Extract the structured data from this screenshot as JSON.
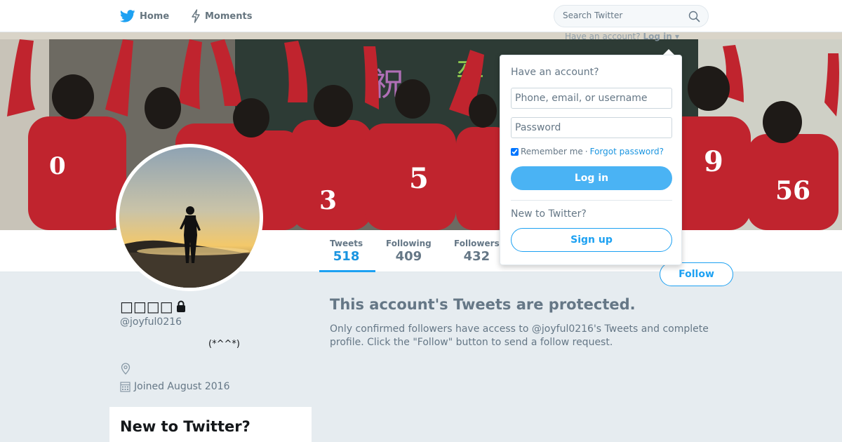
{
  "nav": {
    "home_label": "Home",
    "moments_label": "Moments",
    "search_placeholder": "Search Twitter",
    "login_hint_prefix": "Have an account?",
    "login_hint_link": "Log in ▾"
  },
  "profile_nav": {
    "stats": [
      {
        "label": "Tweets",
        "value": "518"
      },
      {
        "label": "Following",
        "value": "409"
      },
      {
        "label": "Followers",
        "value": "432"
      }
    ],
    "follow_label": "Follow"
  },
  "profile": {
    "name": "□□□□",
    "screen_name": "@joyful0216",
    "bio": "(*^^*)",
    "joined": "Joined August 2016"
  },
  "protected": {
    "title": "This account's Tweets are protected.",
    "text": "Only confirmed followers have access to @joyful0216's Tweets and complete profile. Click the \"Follow\" button to send a follow request."
  },
  "new_card": {
    "title": "New to Twitter?"
  },
  "login_dropdown": {
    "heading": "Have an account?",
    "username_placeholder": "Phone, email, or username",
    "password_placeholder": "Password",
    "remember_label": "Remember me",
    "separator": "·",
    "forgot_label": "Forgot password?",
    "login_label": "Log in",
    "new_heading": "New to Twitter?",
    "signup_label": "Sign up"
  },
  "banner_jerseys": [
    "0",
    "3",
    "5",
    "9",
    "56"
  ],
  "icons": {
    "home": "bird-icon",
    "moments": "lightning-icon",
    "search": "search-icon",
    "location": "location-pin-icon",
    "calendar": "calendar-icon",
    "lock": "lock-icon"
  },
  "colors": {
    "accent": "#1da1f2",
    "link": "#1b95e0",
    "jersey": "#c0242e",
    "background": "#e6ecf0"
  }
}
